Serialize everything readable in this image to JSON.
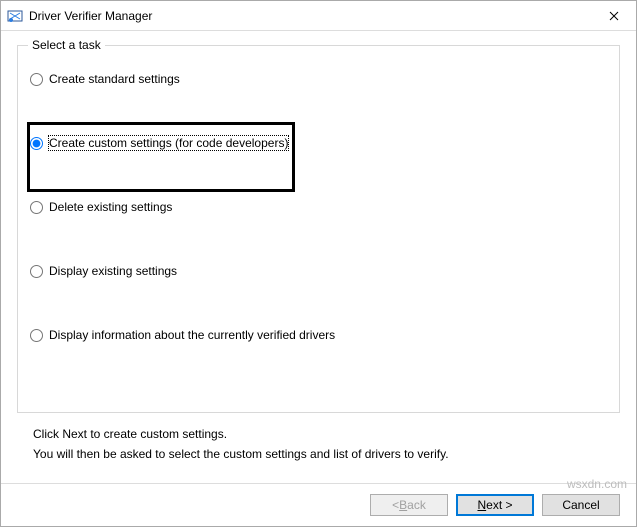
{
  "window": {
    "title": "Driver Verifier Manager"
  },
  "group": {
    "legend": "Select a task",
    "options": {
      "o0": {
        "label": "Create standard settings",
        "checked": false
      },
      "o1": {
        "label": "Create custom settings (for code developers)",
        "checked": true
      },
      "o2": {
        "label": "Delete existing settings",
        "checked": false
      },
      "o3": {
        "label": "Display existing settings",
        "checked": false
      },
      "o4": {
        "label": "Display information about the currently verified drivers",
        "checked": false
      }
    }
  },
  "instructions": {
    "line1": "Click Next to create custom settings.",
    "line2": "You will then be asked to select the custom settings and list of drivers to verify."
  },
  "buttons": {
    "back_prefix": "< ",
    "back_u": "B",
    "back_suffix": "ack",
    "next_u": "N",
    "next_suffix": "ext >",
    "cancel": "Cancel"
  },
  "watermark": "wsxdn.com"
}
